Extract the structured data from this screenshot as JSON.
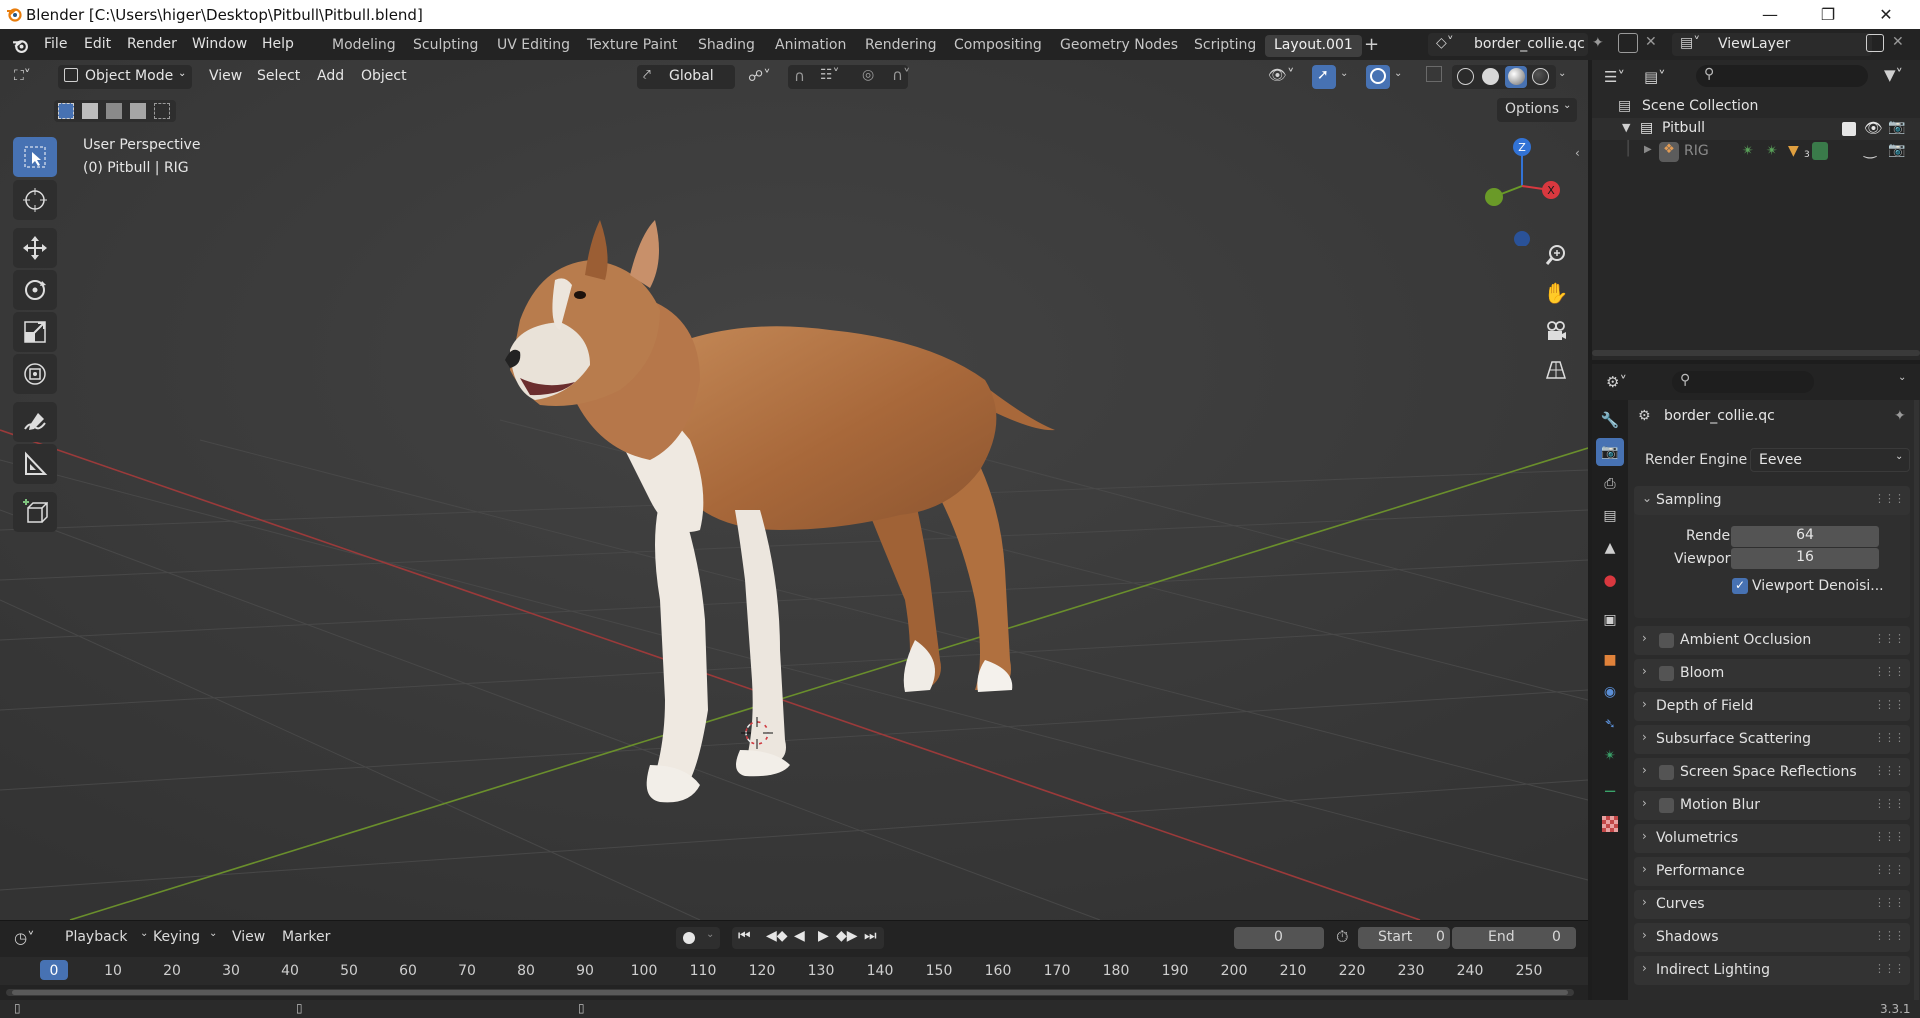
{
  "window": {
    "title": "Blender [C:\\Users\\higer\\Desktop\\Pitbull\\Pitbull.blend]"
  },
  "menu": [
    "File",
    "Edit",
    "Render",
    "Window",
    "Help"
  ],
  "workspaces": [
    "Modeling",
    "Sculpting",
    "UV Editing",
    "Texture Paint",
    "Shading",
    "Animation",
    "Rendering",
    "Compositing",
    "Geometry Nodes",
    "Scripting",
    "Layout.001"
  ],
  "active_workspace": "Layout.001",
  "scene_name": "border_collie.qc",
  "view_layer": "ViewLayer",
  "viewport": {
    "mode": "Object Mode",
    "menus": [
      "View",
      "Select",
      "Add",
      "Object"
    ],
    "transform_orientation": "Global",
    "options_label": "Options",
    "overlay_line1": "User Perspective",
    "overlay_line2": "(0) Pitbull | RIG",
    "gizmo_axes": {
      "z": "Z",
      "x": "X"
    }
  },
  "outliner": {
    "root": "Scene Collection",
    "collection": "Pitbull",
    "object": "RIG",
    "object_badge": "3"
  },
  "properties": {
    "scene_name": "border_collie.qc",
    "render_engine_label": "Render Engine",
    "render_engine": "Eevee",
    "sampling": {
      "title": "Sampling",
      "render_label": "Render",
      "render_value": "64",
      "viewport_label": "Viewport",
      "viewport_value": "16",
      "denoise_label": "Viewport Denoisi..."
    },
    "panels": [
      {
        "label": "Ambient Occlusion",
        "checkbox": true
      },
      {
        "label": "Bloom",
        "checkbox": true
      },
      {
        "label": "Depth of Field",
        "checkbox": false
      },
      {
        "label": "Subsurface Scattering",
        "checkbox": false
      },
      {
        "label": "Screen Space Reflections",
        "checkbox": true
      },
      {
        "label": "Motion Blur",
        "checkbox": true
      },
      {
        "label": "Volumetrics",
        "checkbox": false
      },
      {
        "label": "Performance",
        "checkbox": false
      },
      {
        "label": "Curves",
        "checkbox": false
      },
      {
        "label": "Shadows",
        "checkbox": false
      },
      {
        "label": "Indirect Lighting",
        "checkbox": false
      }
    ]
  },
  "timeline": {
    "menus": [
      "Playback",
      "Keying",
      "View",
      "Marker"
    ],
    "current_frame": "0",
    "start_label": "Start",
    "start_value": "0",
    "end_label": "End",
    "end_value": "0",
    "ticks": [
      "0",
      "10",
      "20",
      "30",
      "40",
      "50",
      "60",
      "70",
      "80",
      "90",
      "100",
      "110",
      "120",
      "130",
      "140",
      "150",
      "160",
      "170",
      "180",
      "190",
      "200",
      "210",
      "220",
      "230",
      "240",
      "250"
    ]
  },
  "status": {
    "version": "3.3.1"
  },
  "colors": {
    "accent": "#4772b3",
    "x_axis": "#d9383f",
    "y_axis": "#6a9a28",
    "z_axis": "#3273d6"
  }
}
